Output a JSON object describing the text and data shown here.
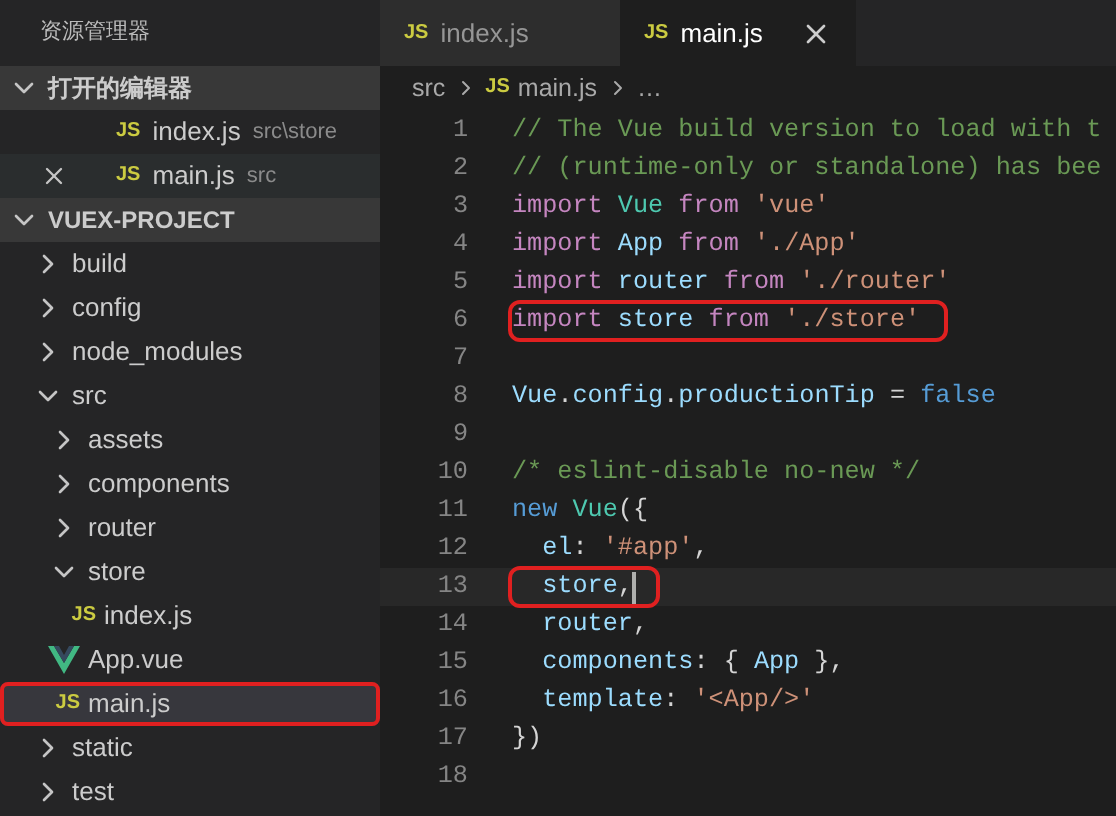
{
  "explorer": {
    "title": "资源管理器",
    "open_editors": {
      "label": "打开的编辑器",
      "expanded": true,
      "items": [
        {
          "icon": "JS",
          "name": "index.js",
          "path": "src\\store",
          "closable": false
        },
        {
          "icon": "JS",
          "name": "main.js",
          "path": "src",
          "closable": true
        }
      ]
    },
    "project": {
      "label": "VUEX-PROJECT",
      "expanded": true,
      "children": [
        {
          "kind": "folder",
          "name": "build",
          "expanded": false,
          "selected": false,
          "highlighted": false
        },
        {
          "kind": "folder",
          "name": "config",
          "expanded": false,
          "selected": false,
          "highlighted": false
        },
        {
          "kind": "folder",
          "name": "node_modules",
          "expanded": false,
          "selected": false,
          "highlighted": false
        },
        {
          "kind": "folder",
          "name": "src",
          "expanded": true,
          "selected": false,
          "highlighted": false,
          "children": [
            {
              "kind": "folder",
              "name": "assets",
              "expanded": false,
              "selected": false,
              "highlighted": false
            },
            {
              "kind": "folder",
              "name": "components",
              "expanded": false,
              "selected": false,
              "highlighted": false
            },
            {
              "kind": "folder",
              "name": "router",
              "expanded": false,
              "selected": false,
              "highlighted": false
            },
            {
              "kind": "folder",
              "name": "store",
              "expanded": true,
              "selected": false,
              "highlighted": false,
              "children": [
                {
                  "kind": "js",
                  "icon": "JS",
                  "name": "index.js",
                  "selected": false,
                  "highlighted": false
                }
              ]
            },
            {
              "kind": "vue",
              "name": "App.vue",
              "selected": false,
              "highlighted": false
            },
            {
              "kind": "js",
              "icon": "JS",
              "name": "main.js",
              "selected": true,
              "highlighted": true
            }
          ]
        },
        {
          "kind": "folder",
          "name": "static",
          "expanded": false,
          "selected": false,
          "highlighted": false
        },
        {
          "kind": "folder",
          "name": "test",
          "expanded": false,
          "selected": false,
          "highlighted": false
        }
      ]
    }
  },
  "tabs": [
    {
      "icon": "JS",
      "label": "index.js",
      "selected": false
    },
    {
      "icon": "JS",
      "label": "main.js",
      "selected": true
    }
  ],
  "breadcrumb": {
    "folder": "src",
    "icon": "JS",
    "file": "main.js",
    "more": "…"
  },
  "code": [
    {
      "number": "1",
      "highlighted": false,
      "tokens": [
        {
          "kind": "comment",
          "text": "// The Vue build version to load with t"
        }
      ]
    },
    {
      "number": "2",
      "highlighted": false,
      "tokens": [
        {
          "kind": "comment",
          "text": "// (runtime-only or standalone) has bee"
        }
      ]
    },
    {
      "number": "3",
      "highlighted": false,
      "tokens": [
        {
          "kind": "keyword",
          "text": "import "
        },
        {
          "kind": "class",
          "text": "Vue"
        },
        {
          "kind": "keyword",
          "text": " from "
        },
        {
          "kind": "string",
          "text": "'vue'"
        }
      ]
    },
    {
      "number": "4",
      "highlighted": false,
      "tokens": [
        {
          "kind": "keyword",
          "text": "import "
        },
        {
          "kind": "variable",
          "text": "App"
        },
        {
          "kind": "keyword",
          "text": " from "
        },
        {
          "kind": "string",
          "text": "'./App'"
        }
      ]
    },
    {
      "number": "5",
      "highlighted": false,
      "tokens": [
        {
          "kind": "keyword",
          "text": "import "
        },
        {
          "kind": "variable",
          "text": "router"
        },
        {
          "kind": "keyword",
          "text": " from "
        },
        {
          "kind": "string",
          "text": "'./router'"
        }
      ]
    },
    {
      "number": "6",
      "highlighted": true,
      "tokens": [
        {
          "kind": "keyword",
          "text": "import "
        },
        {
          "kind": "variable",
          "text": "store"
        },
        {
          "kind": "keyword",
          "text": " from "
        },
        {
          "kind": "string",
          "text": "'./store'"
        }
      ]
    },
    {
      "number": "7"
    },
    {
      "number": "8",
      "highlighted": false,
      "tokens": [
        {
          "kind": "variable",
          "text": "Vue"
        },
        {
          "kind": "plain",
          "text": "."
        },
        {
          "kind": "variable",
          "text": "config"
        },
        {
          "kind": "plain",
          "text": "."
        },
        {
          "kind": "variable",
          "text": "productionTip"
        },
        {
          "kind": "plain",
          "text": " = "
        },
        {
          "kind": "constant",
          "text": "false"
        }
      ]
    },
    {
      "number": "9"
    },
    {
      "number": "10",
      "highlighted": false,
      "tokens": [
        {
          "kind": "comment",
          "text": "/* eslint-disable no-new */"
        }
      ]
    },
    {
      "number": "11",
      "highlighted": false,
      "tokens": [
        {
          "kind": "constant",
          "text": "new "
        },
        {
          "kind": "class",
          "text": "Vue"
        },
        {
          "kind": "plain",
          "text": "({"
        }
      ]
    },
    {
      "number": "12",
      "highlighted": false,
      "tokens": [
        {
          "kind": "variable",
          "text": "  el"
        },
        {
          "kind": "plain",
          "text": ": "
        },
        {
          "kind": "string",
          "text": "'#app'"
        },
        {
          "kind": "plain",
          "text": ","
        }
      ]
    },
    {
      "number": "13",
      "highlighted": true,
      "cursor": true,
      "tokens": [
        {
          "kind": "variable",
          "text": "  store"
        },
        {
          "kind": "plain",
          "text": ","
        }
      ]
    },
    {
      "number": "14",
      "highlighted": false,
      "tokens": [
        {
          "kind": "variable",
          "text": "  router"
        },
        {
          "kind": "plain",
          "text": ","
        }
      ]
    },
    {
      "number": "15",
      "highlighted": false,
      "tokens": [
        {
          "kind": "variable",
          "text": "  components"
        },
        {
          "kind": "plain",
          "text": ": { "
        },
        {
          "kind": "variable",
          "text": "App"
        },
        {
          "kind": "plain",
          "text": " },"
        }
      ]
    },
    {
      "number": "16",
      "highlighted": false,
      "tokens": [
        {
          "kind": "variable",
          "text": "  template"
        },
        {
          "kind": "plain",
          "text": ": "
        },
        {
          "kind": "string",
          "text": "'<App/>'"
        }
      ]
    },
    {
      "number": "17",
      "highlighted": false,
      "tokens": [
        {
          "kind": "plain",
          "text": "})"
        }
      ]
    },
    {
      "number": "18"
    }
  ]
}
